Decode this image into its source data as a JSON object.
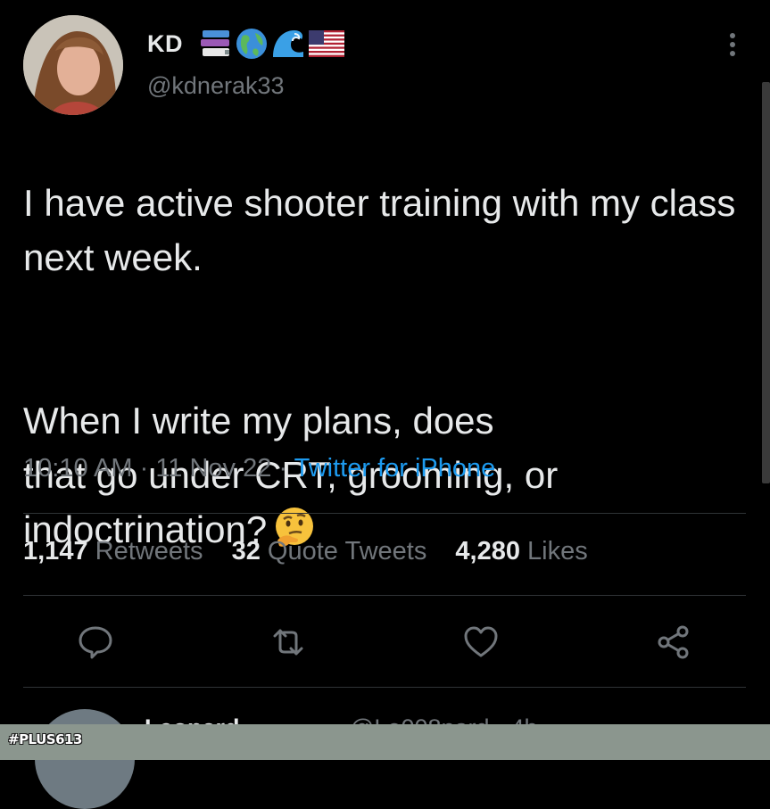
{
  "author": {
    "display_name": "KD",
    "name_emojis": [
      "books-emoji",
      "globe-emoji",
      "wave-emoji",
      "us-flag-emoji"
    ],
    "handle": "@kdnerak33"
  },
  "tweet": {
    "paragraph1": "I have active shooter training with my class next week.",
    "paragraph2": "When I write my plans, does\nthat go under CRT, grooming, or\nindoctrination?",
    "emoji": "thinking-face-emoji"
  },
  "meta": {
    "time": "10:10 AM",
    "separator": " · ",
    "date": "11 Nov 22",
    "source": "Twitter for iPhone"
  },
  "stats": {
    "retweets_count": "1,147",
    "retweets_label": "Retweets",
    "quotes_count": "32",
    "quotes_label": "Quote Tweets",
    "likes_count": "4,280",
    "likes_label": "Likes"
  },
  "actions": [
    "reply-icon",
    "retweet-icon",
    "like-icon",
    "share-icon"
  ],
  "next_tweet": {
    "display_name": "Leonard",
    "handle": "@Le008nard · 4h"
  },
  "watermark": {
    "text": "#PLUS613"
  },
  "colors": {
    "background": "#000000",
    "text": "#e7e9ea",
    "secondary": "#71767b",
    "accent": "#1d9bf0",
    "divider": "#2f3336",
    "footer": "#8b968e"
  }
}
